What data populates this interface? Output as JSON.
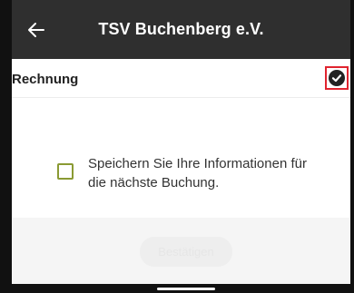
{
  "header": {
    "title": "TSV Buchenberg e.V.",
    "back_icon": "arrow-left-icon"
  },
  "section": {
    "label": "Rechnung",
    "status_icon": "check-circle-icon"
  },
  "save_info": {
    "checked": false,
    "text": "Speichern Sie Ihre Informationen für die nächste Buchung."
  },
  "confirm": {
    "label": "Bestätigen",
    "enabled": false
  },
  "colors": {
    "header_bg": "#2f2f2f",
    "checkbox_border": "#8a9a33",
    "highlight": "#e0242f"
  }
}
